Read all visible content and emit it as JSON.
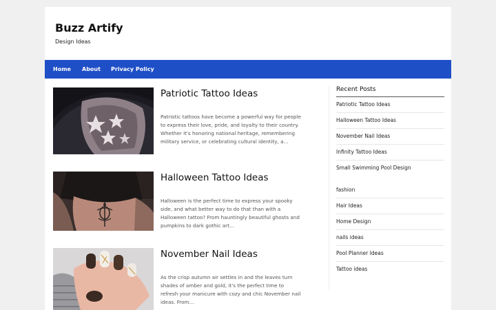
{
  "site": {
    "title": "Buzz Artify",
    "tagline": "Design Ideas"
  },
  "nav": {
    "items": [
      {
        "label": "Home"
      },
      {
        "label": "About"
      },
      {
        "label": "Privacy Policy"
      }
    ]
  },
  "posts": [
    {
      "title": "Patriotic Tattoo Ideas",
      "excerpt": "Patriotic tattoos have become a powerful way for people to express their love, pride, and loyalty to their country. Whether it's honoring national heritage, remembering military service, or celebrating cultural identity, a…",
      "image": "patriotic-tattoo-photo"
    },
    {
      "title": "Halloween Tattoo Ideas",
      "excerpt": "Halloween is the perfect time to express your spooky side, and what better way to do that than with a Halloween tattoo? From hauntingly beautiful ghosts and pumpkins to dark gothic art…",
      "image": "halloween-tattoo-photo"
    },
    {
      "title": "November Nail Ideas",
      "excerpt": "As the crisp autumn air settles in and the leaves turn shades of amber and gold, it's the perfect time to refresh your manicure with cozy and chic November nail ideas. From…",
      "image": "november-nails-photo"
    }
  ],
  "sidebar": {
    "recent_title": "Recent Posts",
    "recent_posts": [
      "Patriotic Tattoo Ideas",
      "Halloween Tattoo Ideas",
      "November Nail Ideas",
      "Infinity Tattoo Ideas",
      "Small Swimming Pool Design"
    ],
    "categories": [
      "fashion",
      "Hair Ideas",
      "Home Design",
      "nails ideas",
      "Pool Planner Ideas",
      "Tattoo ideas"
    ]
  },
  "colors": {
    "nav_background": "#1f4fc7",
    "page_background": "#f0f0f0"
  }
}
